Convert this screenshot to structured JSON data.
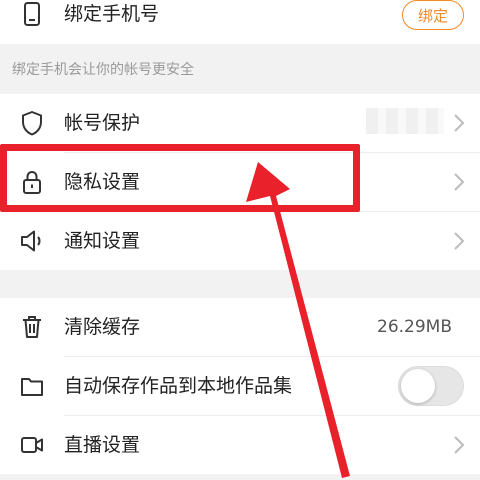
{
  "phone_row": {
    "label": "绑定手机号",
    "bind_button": "绑定",
    "icon": "phone-icon"
  },
  "hint_text": "绑定手机会让你的帐号更安全",
  "menu": {
    "account_protection": {
      "label": "帐号保护",
      "icon": "shield-icon"
    },
    "privacy_settings": {
      "label": "隐私设置",
      "icon": "lock-icon"
    },
    "notification_settings": {
      "label": "通知设置",
      "icon": "speaker-icon"
    },
    "clear_cache": {
      "label": "清除缓存",
      "value": "26.29MB",
      "icon": "trash-icon"
    },
    "auto_save": {
      "label": "自动保存作品到本地作品集",
      "icon": "folder-icon",
      "toggle_on": false
    },
    "live_settings": {
      "label": "直播设置",
      "icon": "video-camera-icon"
    }
  },
  "colors": {
    "accent": "#f08a24",
    "annotation_red": "#e8212b",
    "background_gray": "#f2f2f2"
  }
}
